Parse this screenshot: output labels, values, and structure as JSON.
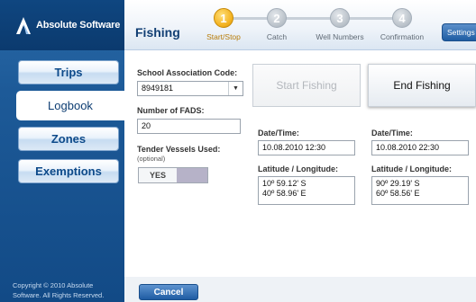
{
  "app": {
    "brand": "Absolute Software"
  },
  "sidebar": {
    "items": [
      {
        "label": "Trips"
      },
      {
        "label": "Logbook"
      },
      {
        "label": "Zones"
      },
      {
        "label": "Exemptions"
      }
    ],
    "copyright": "Copyright © 2010 Absolute Software. All Rights Reserved."
  },
  "header": {
    "title": "Fishing",
    "steps": [
      {
        "number": "1",
        "label": "Start/Stop"
      },
      {
        "number": "2",
        "label": "Catch"
      },
      {
        "number": "3",
        "label": "Well Numbers"
      },
      {
        "number": "4",
        "label": "Confirmation"
      }
    ],
    "settings_label": "Settings"
  },
  "form": {
    "school_code_label": "School Association Code:",
    "school_code_value": "8949181",
    "fads_label": "Number of FADS:",
    "fads_value": "20",
    "tender_label": "Tender Vessels Used:",
    "tender_sublabel": "(optional)",
    "tender_value": "YES"
  },
  "start": {
    "button_label": "Start Fishing",
    "datetime_label": "Date/Time:",
    "datetime_value": "10.08.2010  12:30",
    "latlon_label": "Latitude / Longitude:",
    "lat": "10º 59.12' S",
    "lon": "40º 58.96' E"
  },
  "end": {
    "button_label": "End Fishing",
    "datetime_label": "Date/Time:",
    "datetime_value": "10.08.2010  22:30",
    "latlon_label": "Latitude / Longitude:",
    "lat": "90º 29.19' S",
    "lon": "60º 58.56' E"
  },
  "footer": {
    "cancel_label": "Cancel"
  },
  "colors": {
    "brand_blue": "#1d5a98",
    "active_step": "#f3b11e",
    "cancel_blue": "#1f5ca3"
  }
}
